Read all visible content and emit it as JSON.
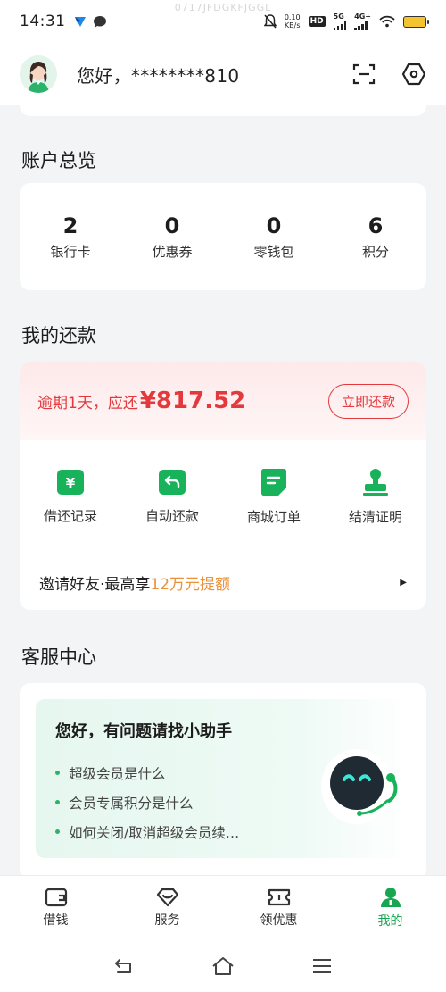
{
  "status_bar": {
    "time": "14:31",
    "network_speed": "0.10\nKB/s",
    "network_speed_top": "0.10",
    "network_speed_bottom": "KB/s",
    "hd_badge": "HD",
    "net_5g": "5G",
    "net_4g": "4G+",
    "watermark": "0717JFDGKFJGGL"
  },
  "header": {
    "greeting": "您好，********810",
    "scan_icon": "scan-icon",
    "settings_icon": "settings-hexagon-icon"
  },
  "overview": {
    "title": "账户总览",
    "items": [
      {
        "value": "2",
        "label": "银行卡"
      },
      {
        "value": "0",
        "label": "优惠券"
      },
      {
        "value": "0",
        "label": "零钱包"
      },
      {
        "value": "6",
        "label": "积分"
      }
    ]
  },
  "repayment": {
    "title": "我的还款",
    "overdue_text": "逾期1天，应还",
    "amount": "¥817.52",
    "button": "立即还款",
    "actions": [
      {
        "label": "借还记录",
        "icon": "yen-note-icon"
      },
      {
        "label": "自动还款",
        "icon": "auto-return-icon"
      },
      {
        "label": "商城订单",
        "icon": "order-note-icon"
      },
      {
        "label": "结清证明",
        "icon": "stamp-icon"
      }
    ],
    "invite_prefix": "邀请好友·最高享",
    "invite_highlight": "12万元提额"
  },
  "service": {
    "title": "客服中心",
    "heading": "您好，有问题请找小助手",
    "questions": [
      "超级会员是什么",
      "会员专属积分是什么",
      "如何关闭/取消超级会员续…"
    ]
  },
  "tabs": [
    {
      "label": "借钱",
      "icon": "wallet-icon"
    },
    {
      "label": "服务",
      "icon": "heart-icon"
    },
    {
      "label": "领优惠",
      "icon": "ticket-icon"
    },
    {
      "label": "我的",
      "icon": "user-icon"
    }
  ],
  "colors": {
    "brand_green": "#18a650",
    "alert_red": "#e4393c",
    "highlight_orange": "#e8923a"
  }
}
